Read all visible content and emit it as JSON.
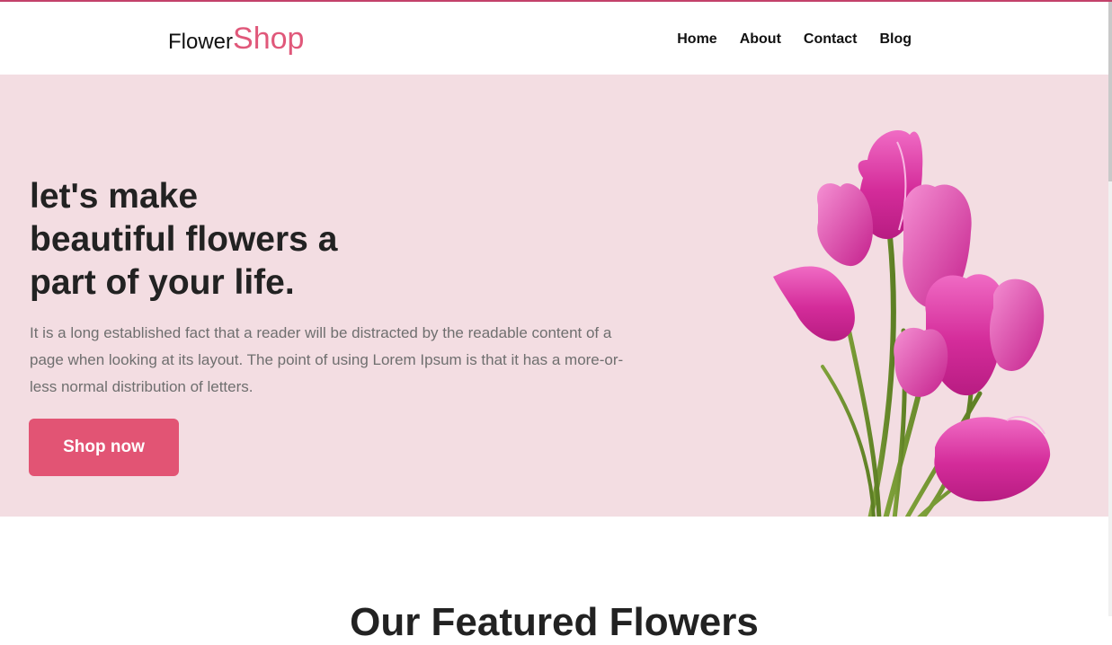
{
  "header": {
    "logo_part1": "Flower",
    "logo_part2": "Shop",
    "nav": {
      "home": "Home",
      "about": "About",
      "contact": "Contact",
      "blog": "Blog"
    }
  },
  "hero": {
    "title_line1": "let's make",
    "title_line2": "beautiful flowers a",
    "title_line3": "part of your life.",
    "description": "It is a long established fact that a reader will be distracted by the readable content of a page when looking at its layout. The point of using Lorem Ipsum is that it has a more-or-less normal distribution of letters.",
    "cta_label": "Shop now",
    "image_icon": "tulip-bouquet"
  },
  "featured": {
    "title": "Our Featured Flowers"
  },
  "colors": {
    "accent": "#e25474",
    "hero_background": "#f3dde2",
    "logo_accent": "#e0587a",
    "top_border": "#c3416a"
  }
}
